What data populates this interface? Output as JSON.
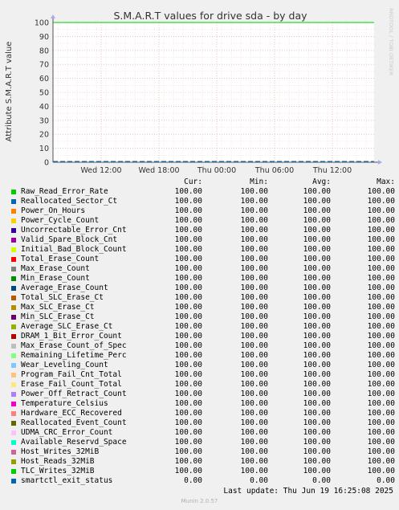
{
  "chart_data": {
    "type": "line",
    "title": "S.M.A.R.T values for drive sda - by day",
    "ylabel": "Attribute S.M.A.R.T value",
    "watermark": "RRDTOOL / TOBI OETIKER",
    "ylim": [
      0,
      100
    ],
    "yticks": [
      "0",
      "10",
      "20",
      "30",
      "40",
      "50",
      "60",
      "70",
      "80",
      "90",
      "100"
    ],
    "xticks": [
      "Wed 12:00",
      "Wed 18:00",
      "Thu 00:00",
      "Thu 06:00",
      "Thu 12:00"
    ],
    "grid": true,
    "series": [
      {
        "name": "Raw_Read_Error_Rate",
        "color": "#00cc00",
        "cur": "100.00",
        "min": "100.00",
        "avg": "100.00",
        "max": "100.00"
      },
      {
        "name": "Reallocated_Sector_Ct",
        "color": "#0066b3",
        "cur": "100.00",
        "min": "100.00",
        "avg": "100.00",
        "max": "100.00"
      },
      {
        "name": "Power_On_Hours",
        "color": "#ff8000",
        "cur": "100.00",
        "min": "100.00",
        "avg": "100.00",
        "max": "100.00"
      },
      {
        "name": "Power_Cycle_Count",
        "color": "#ffcc00",
        "cur": "100.00",
        "min": "100.00",
        "avg": "100.00",
        "max": "100.00"
      },
      {
        "name": "Uncorrectable_Error_Cnt",
        "color": "#330099",
        "cur": "100.00",
        "min": "100.00",
        "avg": "100.00",
        "max": "100.00"
      },
      {
        "name": "Valid_Spare_Block_Cnt",
        "color": "#990099",
        "cur": "100.00",
        "min": "100.00",
        "avg": "100.00",
        "max": "100.00"
      },
      {
        "name": "Initial_Bad_Block_Count",
        "color": "#ccff00",
        "cur": "100.00",
        "min": "100.00",
        "avg": "100.00",
        "max": "100.00"
      },
      {
        "name": "Total_Erase_Count",
        "color": "#ff0000",
        "cur": "100.00",
        "min": "100.00",
        "avg": "100.00",
        "max": "100.00"
      },
      {
        "name": "Max_Erase_Count",
        "color": "#808080",
        "cur": "100.00",
        "min": "100.00",
        "avg": "100.00",
        "max": "100.00"
      },
      {
        "name": "Min_Erase_Count",
        "color": "#008f00",
        "cur": "100.00",
        "min": "100.00",
        "avg": "100.00",
        "max": "100.00"
      },
      {
        "name": "Average_Erase_Count",
        "color": "#00487d",
        "cur": "100.00",
        "min": "100.00",
        "avg": "100.00",
        "max": "100.00"
      },
      {
        "name": "Total_SLC_Erase_Ct",
        "color": "#b35a00",
        "cur": "100.00",
        "min": "100.00",
        "avg": "100.00",
        "max": "100.00"
      },
      {
        "name": "Max_SLC_Erase_Ct",
        "color": "#b38f00",
        "cur": "100.00",
        "min": "100.00",
        "avg": "100.00",
        "max": "100.00"
      },
      {
        "name": "Min_SLC_Erase_Ct",
        "color": "#6b006b",
        "cur": "100.00",
        "min": "100.00",
        "avg": "100.00",
        "max": "100.00"
      },
      {
        "name": "Average_SLC_Erase_Ct",
        "color": "#8fb300",
        "cur": "100.00",
        "min": "100.00",
        "avg": "100.00",
        "max": "100.00"
      },
      {
        "name": "DRAM_1_Bit_Error_Count",
        "color": "#b30000",
        "cur": "100.00",
        "min": "100.00",
        "avg": "100.00",
        "max": "100.00"
      },
      {
        "name": "Max_Erase_Count_of_Spec",
        "color": "#bebebe",
        "cur": "100.00",
        "min": "100.00",
        "avg": "100.00",
        "max": "100.00"
      },
      {
        "name": "Remaining_Lifetime_Perc",
        "color": "#80ff80",
        "cur": "100.00",
        "min": "100.00",
        "avg": "100.00",
        "max": "100.00"
      },
      {
        "name": "Wear_Leveling_Count",
        "color": "#80c9ff",
        "cur": "100.00",
        "min": "100.00",
        "avg": "100.00",
        "max": "100.00"
      },
      {
        "name": "Program_Fail_Cnt_Total",
        "color": "#ffc080",
        "cur": "100.00",
        "min": "100.00",
        "avg": "100.00",
        "max": "100.00"
      },
      {
        "name": "Erase_Fail_Count_Total",
        "color": "#ffe680",
        "cur": "100.00",
        "min": "100.00",
        "avg": "100.00",
        "max": "100.00"
      },
      {
        "name": "Power_Off_Retract_Count",
        "color": "#aa80ff",
        "cur": "100.00",
        "min": "100.00",
        "avg": "100.00",
        "max": "100.00"
      },
      {
        "name": "Temperature_Celsius",
        "color": "#ee00cc",
        "cur": "100.00",
        "min": "100.00",
        "avg": "100.00",
        "max": "100.00"
      },
      {
        "name": "Hardware_ECC_Recovered",
        "color": "#ff8080",
        "cur": "100.00",
        "min": "100.00",
        "avg": "100.00",
        "max": "100.00"
      },
      {
        "name": "Reallocated_Event_Count",
        "color": "#666600",
        "cur": "100.00",
        "min": "100.00",
        "avg": "100.00",
        "max": "100.00"
      },
      {
        "name": "UDMA_CRC_Error_Count",
        "color": "#ffbfff",
        "cur": "100.00",
        "min": "100.00",
        "avg": "100.00",
        "max": "100.00"
      },
      {
        "name": "Available_Reservd_Space",
        "color": "#00ffcc",
        "cur": "100.00",
        "min": "100.00",
        "avg": "100.00",
        "max": "100.00"
      },
      {
        "name": "Host_Writes_32MiB",
        "color": "#cc6699",
        "cur": "100.00",
        "min": "100.00",
        "avg": "100.00",
        "max": "100.00"
      },
      {
        "name": "Host_Reads_32MiB",
        "color": "#999900",
        "cur": "100.00",
        "min": "100.00",
        "avg": "100.00",
        "max": "100.00"
      },
      {
        "name": "TLC_Writes_32MiB",
        "color": "#00cc00",
        "cur": "100.00",
        "min": "100.00",
        "avg": "100.00",
        "max": "100.00"
      },
      {
        "name": "smartctl_exit_status",
        "color": "#0066b3",
        "cur": "0.00",
        "min": "0.00",
        "avg": "0.00",
        "max": "0.00"
      }
    ]
  },
  "legend": {
    "cur_label": "Cur:",
    "min_label": "Min:",
    "avg_label": "Avg:",
    "max_label": "Max:"
  },
  "footer": {
    "last_update": "Last update: Thu Jun 19 16:25:08 2025",
    "version": "Munin 2.0.57"
  }
}
